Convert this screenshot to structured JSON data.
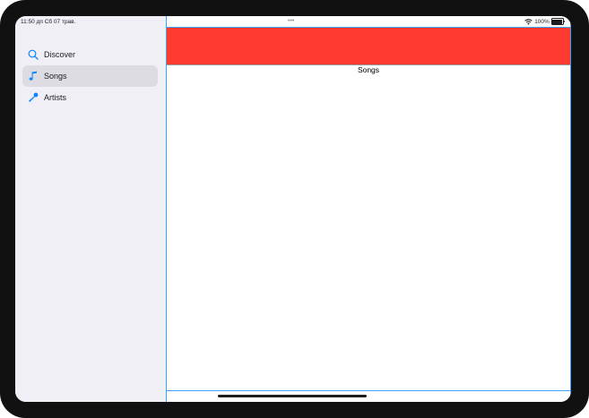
{
  "status_bar": {
    "time": "11:50 дп  Сб 07 трав.",
    "dots": "•••",
    "battery": "100%",
    "wifi_icon": "wifi-icon",
    "battery_icon": "battery-icon"
  },
  "sidebar": {
    "items": [
      {
        "label": "Discover",
        "icon": "magnifying-glass-icon",
        "selected": false
      },
      {
        "label": "Songs",
        "icon": "music-note-icon",
        "selected": true
      },
      {
        "label": "Artists",
        "icon": "microphone-icon",
        "selected": false
      }
    ]
  },
  "detail": {
    "title": "Songs",
    "header_color": "#ff3b30"
  },
  "colors": {
    "accent": "#0a84ff",
    "sidebar_bg": "#f0eff6",
    "selected_bg": "#dcdce2"
  }
}
